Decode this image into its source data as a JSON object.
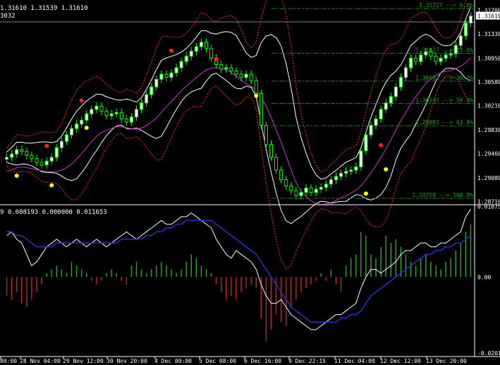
{
  "header": {
    "ohlc_text": "1.31610 1.31539 1.31610",
    "code_text": "3032"
  },
  "indicator_header": {
    "text": "9 0.008193 0.000000 0.011653"
  },
  "colors": {
    "background": "#000000",
    "candle_bull": "#00ff00",
    "candle_body_bull": "#ffffff",
    "candle_bear": "#00ff00",
    "bb_upper_lower": "#ffffff",
    "envelope": "#ff3333",
    "magenta_line": "#cc33cc",
    "fib": "#1f7f1f",
    "fib_text": "#00aa00",
    "hist_up": "#2ea82e",
    "hist_down": "#cc2222",
    "signal_white": "#ffffff",
    "signal_blue": "#2233cc",
    "fractal_red": "#ff2222",
    "fractal_yellow": "#ffff00",
    "axis_text": "#ffffff",
    "grid": "#ffffff"
  },
  "chart_data": [
    {
      "type": "candlestick",
      "title": "",
      "price_axis_labels": [
        "1.31700",
        "1.31610",
        "1.31330",
        "1.30950",
        "1.30580",
        "1.30210",
        "1.29830",
        "1.29460",
        "1.29080",
        "1.28710"
      ],
      "current_price": "1.31610",
      "ylim": [
        1.2868,
        1.3175
      ],
      "time_axis_labels": [
        "00:00",
        "28 Nov 04:00",
        "29 Nov 12:00",
        "30 Nov 20:00",
        "4 Dec 00:00",
        "5 Dec 08:00",
        "6 Dec 16:00",
        "9 Dec 22:15",
        "11 Dec 04:00",
        "12 Dec 12:00",
        "13 Dec 20:00"
      ],
      "fibonacci_levels": [
        {
          "label": "1.31727 --> 0.0%",
          "value": 1.31727
        },
        {
          "label": "1.31027 --> 23.6%",
          "value": 1.31027
        },
        {
          "label": "1.30592 --> 38.2%",
          "value": 1.30592
        },
        {
          "label": "1.30243 --> 50.0%",
          "value": 1.30243
        },
        {
          "label": "1.29893 --> 61.8%",
          "value": 1.29893
        },
        {
          "label": "1.28759 --> 100.0%",
          "value": 1.28759
        }
      ],
      "close_series": [
        1.294,
        1.2945,
        1.2952,
        1.2949,
        1.2943,
        1.2938,
        1.2932,
        1.2928,
        1.2934,
        1.294,
        1.2955,
        1.2965,
        1.2975,
        1.2985,
        1.2992,
        1.2998,
        1.3008,
        1.3015,
        1.302,
        1.3012,
        1.3005,
        1.3008,
        1.301,
        1.3,
        1.2995,
        1.3003,
        1.3015,
        1.3025,
        1.3038,
        1.305,
        1.3062,
        1.307,
        1.3065,
        1.3072,
        1.308,
        1.309,
        1.3098,
        1.3106,
        1.3113,
        1.312,
        1.311,
        1.3095,
        1.3085,
        1.3078,
        1.308,
        1.3075,
        1.307,
        1.3065,
        1.307,
        1.306,
        1.304,
        1.299,
        1.296,
        1.294,
        1.292,
        1.2905,
        1.2895,
        1.2888,
        1.288,
        1.2885,
        1.2892,
        1.2885,
        1.289,
        1.2893,
        1.2898,
        1.2905,
        1.291,
        1.2915,
        1.2918,
        1.292,
        1.2925,
        1.295,
        1.2975,
        1.299,
        1.3,
        1.3015,
        1.3025,
        1.3035,
        1.305,
        1.3065,
        1.308,
        1.3095,
        1.309,
        1.31,
        1.3105,
        1.3098,
        1.309,
        1.3095,
        1.31,
        1.3102,
        1.3115,
        1.313,
        1.315,
        1.3161
      ],
      "fractals_up_price": [
        1.2949,
        1.302,
        1.3098,
        1.3085,
        1.295
      ],
      "fractals_down_price": [
        1.292,
        1.2905,
        1.2995,
        1.3045,
        1.2892,
        1.293
      ]
    },
    {
      "type": "histogram+lines",
      "indicator_values": [
        "0.008193",
        "0.000000",
        "0.011653"
      ],
      "axis_labels": [
        "0.018752",
        "0.00",
        "-0.020181"
      ],
      "ylim": [
        -0.0202,
        0.0188
      ],
      "histogram": [
        -0.005,
        -0.006,
        -0.004,
        -0.007,
        -0.008,
        -0.006,
        -0.004,
        -0.002,
        0.001,
        0.002,
        0.003,
        0.002,
        0.001,
        0.004,
        0.003,
        0.002,
        0.001,
        -0.001,
        -0.002,
        -0.001,
        0.001,
        0.002,
        0.001,
        -0.001,
        -0.002,
        0.003,
        0.004,
        0.002,
        0.001,
        0.002,
        0.003,
        0.004,
        0.003,
        0.002,
        0.001,
        0.002,
        0.004,
        0.006,
        0.005,
        0.003,
        0.002,
        0.001,
        -0.002,
        -0.004,
        -0.006,
        -0.005,
        -0.006,
        -0.004,
        -0.003,
        -0.002,
        -0.003,
        -0.011,
        -0.017,
        -0.014,
        -0.01,
        -0.012,
        -0.013,
        -0.008,
        -0.006,
        -0.004,
        -0.003,
        -0.002,
        -0.001,
        0.001,
        -0.001,
        0.002,
        -0.002,
        -0.004,
        0.003,
        0.005,
        0.006,
        0.012,
        0.011,
        0.006,
        0.005,
        0.008,
        0.011,
        0.009,
        0.01,
        0.008,
        0.006,
        0.004,
        0.003,
        0.005,
        0.006,
        0.004,
        0.003,
        0.002,
        0.004,
        0.005,
        0.007,
        0.009,
        0.012,
        0.014
      ],
      "white_line": [
        0.011,
        0.012,
        0.01,
        0.009,
        0.006,
        0.003,
        0.004,
        0.006,
        0.008,
        0.009,
        0.01,
        0.009,
        0.008,
        0.009,
        0.01,
        0.009,
        0.008,
        0.009,
        0.01,
        0.009,
        0.008,
        0.009,
        0.01,
        0.011,
        0.012,
        0.011,
        0.01,
        0.011,
        0.012,
        0.013,
        0.014,
        0.015,
        0.014,
        0.014,
        0.015,
        0.016,
        0.016,
        0.017,
        0.016,
        0.015,
        0.014,
        0.013,
        0.01,
        0.008,
        0.006,
        0.005,
        0.007,
        0.006,
        0.005,
        0.004,
        0.002,
        -0.002,
        -0.005,
        -0.007,
        -0.007,
        -0.006,
        -0.008,
        -0.01,
        -0.011,
        -0.012,
        -0.013,
        -0.014,
        -0.014,
        -0.013,
        -0.012,
        -0.011,
        -0.01,
        -0.01,
        -0.009,
        -0.008,
        -0.007,
        -0.003,
        0.0,
        0.002,
        0.002,
        0.001,
        0.002,
        0.003,
        0.004,
        0.006,
        0.007,
        0.007,
        0.008,
        0.009,
        0.009,
        0.008,
        0.008,
        0.009,
        0.009,
        0.01,
        0.011,
        0.012,
        0.016,
        0.018
      ],
      "blue_line": [
        0.012,
        0.012,
        0.011,
        0.011,
        0.01,
        0.009,
        0.008,
        0.008,
        0.008,
        0.008,
        0.009,
        0.009,
        0.009,
        0.009,
        0.009,
        0.009,
        0.009,
        0.009,
        0.009,
        0.009,
        0.009,
        0.009,
        0.009,
        0.01,
        0.01,
        0.01,
        0.01,
        0.01,
        0.011,
        0.011,
        0.012,
        0.012,
        0.013,
        0.013,
        0.014,
        0.014,
        0.015,
        0.015,
        0.015,
        0.015,
        0.015,
        0.015,
        0.014,
        0.013,
        0.012,
        0.011,
        0.01,
        0.009,
        0.008,
        0.007,
        0.006,
        0.004,
        0.002,
        0.0,
        -0.002,
        -0.004,
        -0.006,
        -0.008,
        -0.009,
        -0.01,
        -0.011,
        -0.012,
        -0.012,
        -0.012,
        -0.012,
        -0.012,
        -0.012,
        -0.011,
        -0.011,
        -0.01,
        -0.01,
        -0.009,
        -0.007,
        -0.005,
        -0.004,
        -0.003,
        -0.002,
        -0.001,
        0.0,
        0.001,
        0.002,
        0.003,
        0.004,
        0.005,
        0.006,
        0.006,
        0.007,
        0.007,
        0.008,
        0.008,
        0.009,
        0.009,
        0.01,
        0.011
      ]
    }
  ]
}
